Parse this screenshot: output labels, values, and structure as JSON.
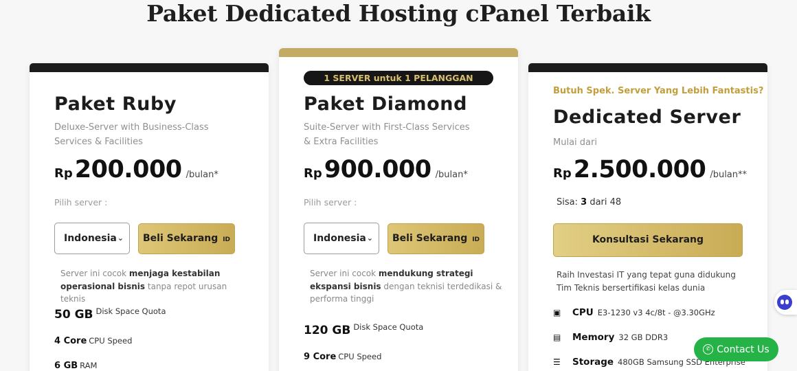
{
  "heading": "Paket Dedicated Hosting cPanel Terbaik",
  "ruby": {
    "name": "Paket Ruby",
    "desc": "Deluxe-Server with Business-Class Services & Facilities",
    "currency": "Rp",
    "price": "200.000",
    "per": "/bulan*",
    "pilih": "Pilih server :",
    "server": "Indonesia",
    "buy": "Beli Sekarang",
    "flag": "ID",
    "note_pre": "Server ini cocok ",
    "note_bold": "menjaga kestabilan operasional bisnis",
    "note_post": " tanpa repot urusan teknis",
    "specs": [
      {
        "value": "50 GB",
        "label": "Disk Space Quota"
      },
      {
        "value": "4 Core",
        "label": "CPU Speed"
      },
      {
        "value": "6 GB",
        "label": "RAM"
      }
    ]
  },
  "diamond": {
    "ribbon": "1 SERVER untuk 1 PELANGGAN",
    "name": "Paket Diamond",
    "desc": "Suite-Server with First-Class Services & Extra Facilities",
    "currency": "Rp",
    "price": "900.000",
    "per": "/bulan*",
    "pilih": "Pilih server :",
    "server": "Indonesia",
    "buy": "Beli Sekarang",
    "flag": "ID",
    "note_pre": "Server ini cocok ",
    "note_bold": "mendukung strategi ekspansi bisnis",
    "note_post": " dengan teknisi terdedikasi & performa tinggi",
    "specs": [
      {
        "value": "120 GB",
        "label": "Disk Space Quota"
      },
      {
        "value": "9 Core",
        "label": "CPU Speed"
      }
    ]
  },
  "dedicated": {
    "eyebrow": "Butuh Spek. Server Yang Lebih Fantastis?",
    "name": "Dedicated Server",
    "mulai": "Mulai dari",
    "currency": "Rp",
    "price": "2.500.000",
    "per": "/bulan**",
    "sisa_label": "Sisa:",
    "sisa_count": "3",
    "sisa_total": "dari 48",
    "cta": "Konsultasi Sekarang",
    "note": "Raih Investasi IT yang tepat guna didukung Tim Teknis bersertifikasi kelas dunia",
    "specs": [
      {
        "icon": "cpu-icon",
        "label": "CPU",
        "value": "E3-1230 v3 4c/8t - @3.30GHz"
      },
      {
        "icon": "memory-icon",
        "label": "Memory",
        "value": "32 GB DDR3"
      },
      {
        "icon": "storage-icon",
        "label": "Storage",
        "value": "480GB Samsung SSD Enterprise"
      }
    ]
  },
  "contact": "Contact Us",
  "colors": {
    "gold": "#c9ac55",
    "dark": "#1b1b1b",
    "whatsapp": "#25b347",
    "bot": "#3b3fd0"
  }
}
